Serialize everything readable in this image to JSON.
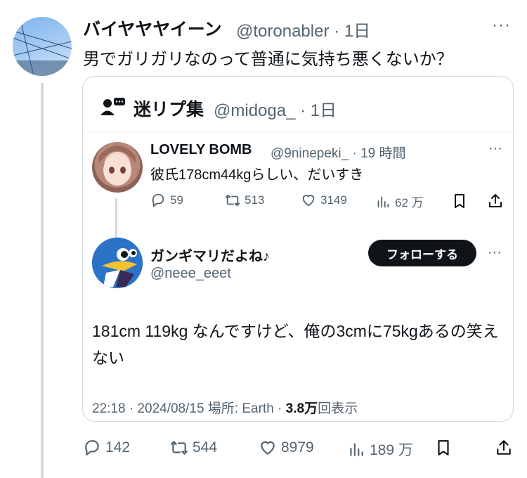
{
  "tweet": {
    "author_name": "バイヤヤヤイーン",
    "handle_time": "@toronabler · 1日",
    "more": "···",
    "text": "男でガリガリなのって普通に気持ち悪くないか？"
  },
  "quote": {
    "author_name": "迷リプ集",
    "handle_time": "@midoga_ · 1日",
    "reply1": {
      "name": "LOVELY BOMB",
      "handle_time": "@9ninepeki_ · 19 時間",
      "more": "···",
      "text": "彼氏178cm44kgらしい、だいすき",
      "replies": "59",
      "retweets": "513",
      "likes": "3149",
      "views": "62 万"
    },
    "reply2": {
      "name": "ガンギマリだよね♪",
      "handle": "@neee_eeet",
      "follow_label": "フォローする",
      "more": "···",
      "text": "181cm 119kg なんですけど、俺の3cmに75kgあるの笑えない",
      "timestamp": "22:18 · 2024/08/15 場所: Earth · ",
      "views_count": "3.8万",
      "views_label": "回表示"
    }
  },
  "actions": {
    "replies": "142",
    "retweets": "544",
    "likes": "8979",
    "views": "189 万"
  },
  "colors": {
    "muted": "#536471",
    "text": "#0f1419",
    "border": "#cfd9de"
  }
}
